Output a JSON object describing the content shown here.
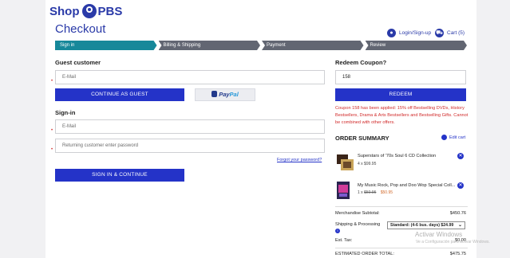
{
  "header": {
    "logo_text_left": "Shop",
    "logo_text_right": "PBS",
    "title": "Checkout",
    "login_label": "Login/Sign-up",
    "cart_label": "Cart (5)"
  },
  "steps": [
    "Sign in",
    "Billing & Shipping",
    "Payment",
    "Review"
  ],
  "guest": {
    "heading": "Guest customer",
    "email_placeholder": "E-Mail",
    "continue_label": "CONTINUE AS GUEST",
    "paypal_part1": "Pay",
    "paypal_part2": "Pal"
  },
  "signin": {
    "heading": "Sign-in",
    "email_placeholder": "E-Mail",
    "password_placeholder": "Returning customer enter password",
    "forgot_label": "Forgot your password?",
    "submit_label": "SIGN IN & CONTINUE"
  },
  "coupon": {
    "heading": "Redeem Coupon?",
    "value": "158",
    "redeem_label": "REDEEM",
    "message": "Coupon 158 has been applied: 15% off Bestselling DVDs, History Bestsellers, Drama & Arts Bestsellers and Bestselling Gifts. Cannot be combined with other offers."
  },
  "order": {
    "heading": "ORDER SUMMARY",
    "edit_label": "Edit cart",
    "items": [
      {
        "name": "Superstars of '70s Soul 6 CD Collection",
        "qty_price": "4 x $99.95",
        "old_price": "",
        "sale_price": ""
      },
      {
        "name": "My Music Rock, Pop and Doo Wop Special Coll...",
        "qty_price": "1 x",
        "old_price": "$50.95",
        "sale_price": "$50.95"
      }
    ],
    "subtotal_label": "Merchandise Subtotal:",
    "subtotal_value": "$450.76",
    "shipping_label": "Shipping & Processing",
    "shipping_option": "Standard: (4-6 bus. days) $24.99",
    "tax_label": "Est. Tax:",
    "tax_value": "$0.00",
    "total_label": "ESTIMATED ORDER TOTAL:",
    "total_value": "$475.75"
  },
  "overlay": {
    "line1": "Activar Windows",
    "line2": "Ve a Configuración para activar Windows."
  },
  "colors": {
    "brand_blue": "#2a3aa8",
    "button_blue": "#2433c8",
    "active_step": "#17889a",
    "inactive_step": "#626672",
    "error_red": "#d12b2b"
  }
}
